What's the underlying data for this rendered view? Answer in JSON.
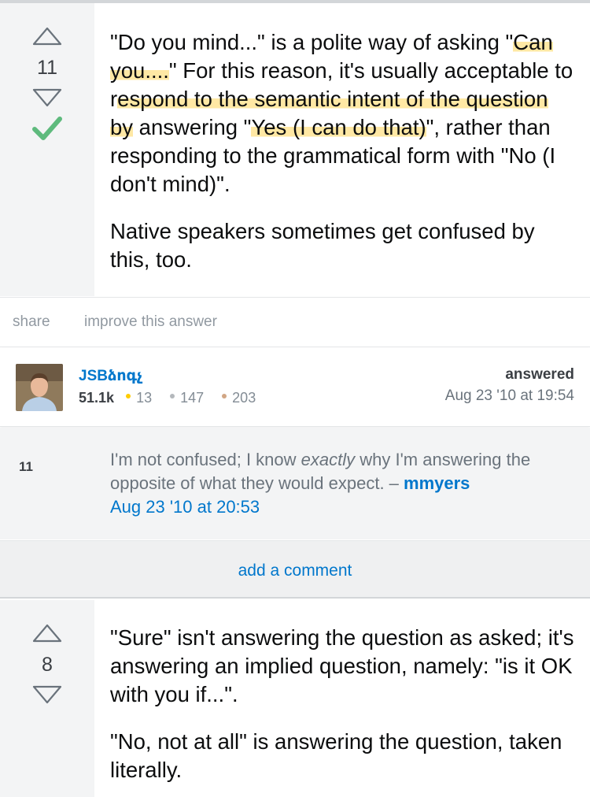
{
  "answers": [
    {
      "score": "11",
      "accepted": true,
      "body": {
        "p1": {
          "t1": "\"Do you mind...\" is a polite way of asking \"",
          "h1": "Can you....",
          "t2": "\" For this reason, it's usually acceptable to r",
          "h2": "espond to the semantic intent of the question by",
          "t3": " answering \"",
          "h3": "Yes (I can do that)",
          "t4": "\", rather than responding to the grammatical form with \"No (I don't mind)\"."
        },
        "p2": "Native speakers sometimes get confused by this, too."
      },
      "actions": {
        "share": "share",
        "improve": "improve this answer"
      },
      "user": {
        "name": "JSBձոգչ",
        "reputation": "51.1k",
        "gold": "13",
        "silver": "147",
        "bronze": "203",
        "answered_label": "answered",
        "answered_date": "Aug 23 '10 at 19:54"
      },
      "comment": {
        "score": "11",
        "text_before": "I'm not confused; I know ",
        "text_em": "exactly",
        "text_after": " why I'm answering the opposite of what they would expect. – ",
        "author": "mmyers",
        "date": "Aug 23 '10 at 20:53"
      },
      "add_comment": "add a comment"
    },
    {
      "score": "8",
      "accepted": false,
      "body": {
        "p1": "\"Sure\" isn't answering the question as asked; it's answering an implied question, namely: \"is it OK with you if...\".",
        "p2": "\"No, not at all\" is answering the question, taken literally."
      }
    }
  ],
  "colors": {
    "link": "#0077cc",
    "accepted_check": "#5eba7d",
    "highlight": "#ffd65a",
    "badge_gold": "#ffcc01",
    "badge_silver": "#b4b8bc",
    "badge_bronze": "#d1a684"
  },
  "icons": {
    "upvote": "triangle-up-outline",
    "downvote": "triangle-down-outline",
    "accepted": "checkmark"
  }
}
